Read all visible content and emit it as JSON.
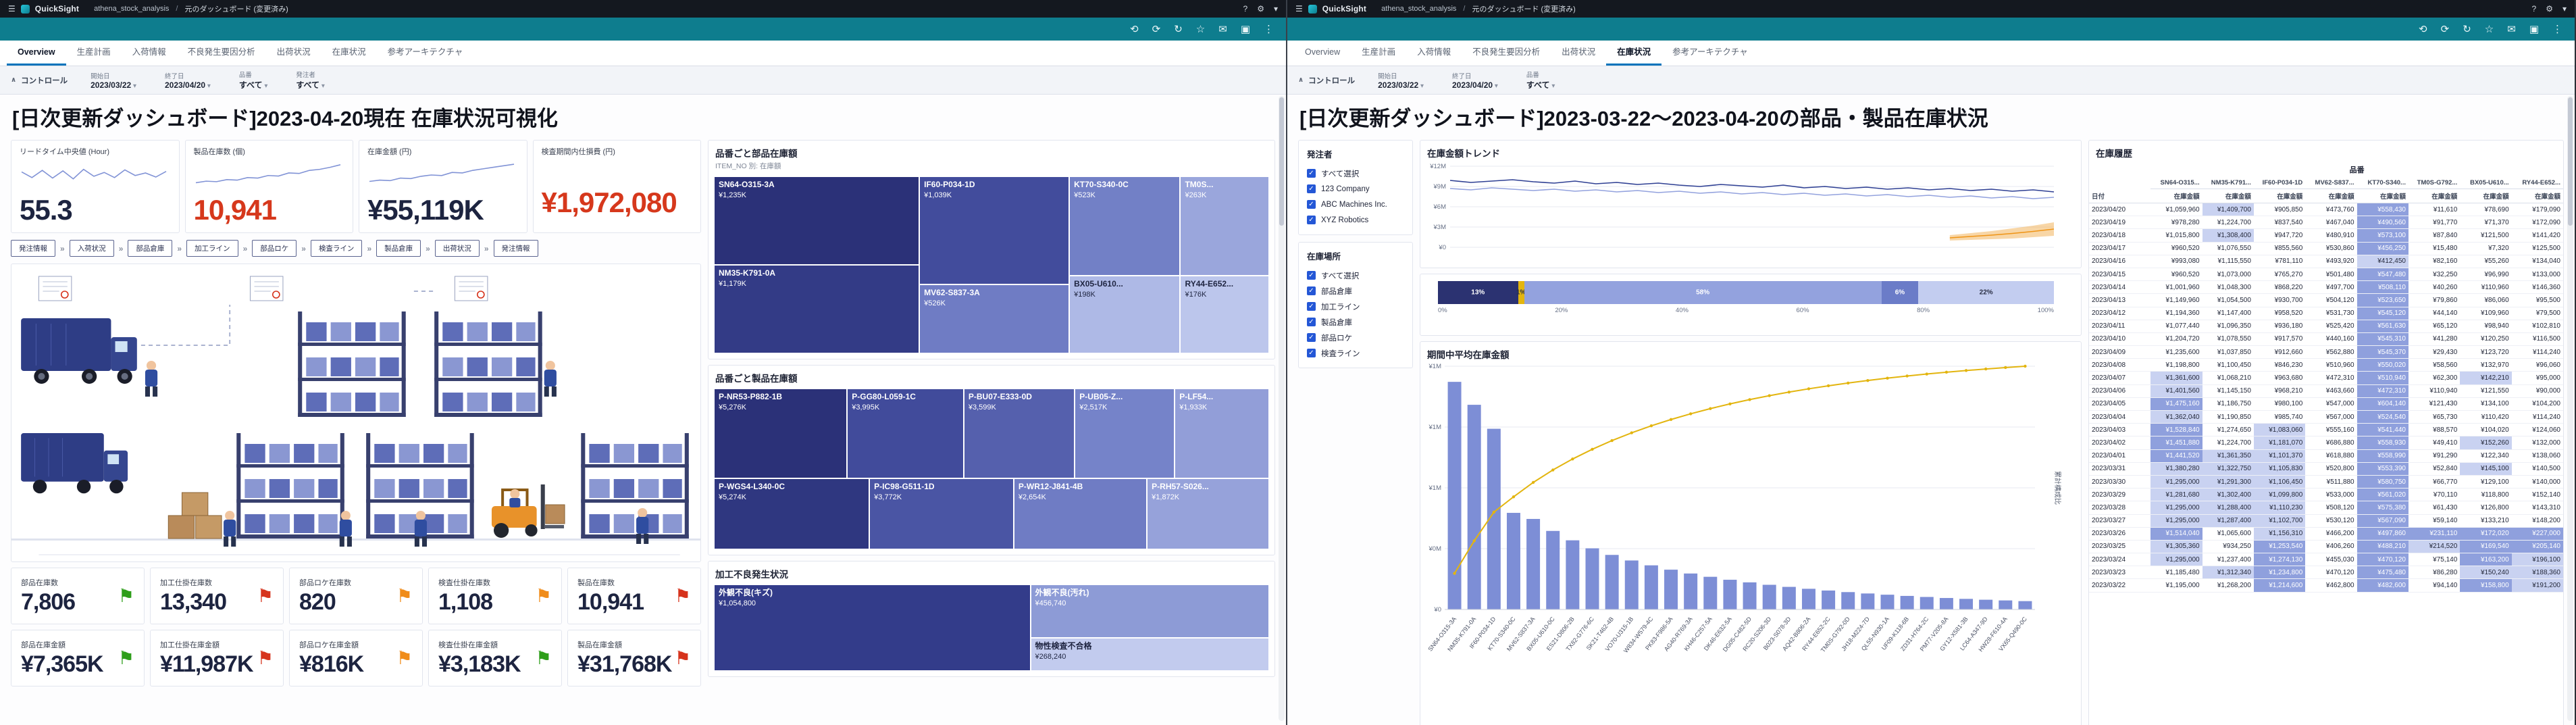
{
  "chrome": {
    "logo": "QuickSight",
    "menu_glyph": "☰",
    "breadcrumb": {
      "project": "athena_stock_analysis",
      "separator": "/",
      "page": "元のダッシュボード (変更済み)"
    },
    "top_icons": [
      {
        "name": "help-icon",
        "glyph": "?"
      },
      {
        "name": "settings-icon",
        "glyph": "⚙"
      },
      {
        "name": "user-menu-icon",
        "glyph": "▾"
      }
    ],
    "teal_icons": [
      {
        "name": "undo-icon",
        "glyph": "⟲"
      },
      {
        "name": "redo-icon",
        "glyph": "⟳"
      },
      {
        "name": "refresh-icon",
        "glyph": "↻"
      },
      {
        "name": "bookmark-icon",
        "glyph": "☆"
      },
      {
        "name": "email-report-icon",
        "glyph": "✉"
      },
      {
        "name": "fullscreen-icon",
        "glyph": "▣"
      },
      {
        "name": "more-menu-icon",
        "glyph": "⋮"
      }
    ],
    "tabs": [
      "Overview",
      "生産計画",
      "入荷情報",
      "不良発生要因分析",
      "出荷状況",
      "在庫状況",
      "参考アーキテクチャ"
    ]
  },
  "left": {
    "active_tab": "Overview",
    "controls": {
      "section_label": "コントロール",
      "items": [
        {
          "label": "開始日",
          "value": "2023/03/22"
        },
        {
          "label": "終了日",
          "value": "2023/04/20"
        },
        {
          "label": "品番",
          "value": "すべて"
        },
        {
          "label": "発注者",
          "value": "すべて"
        }
      ]
    },
    "title": "[日次更新ダッシュボード]2023-04-20現在 在庫状況可視化",
    "kpis": [
      {
        "label": "リードタイム中央値 (Hour)",
        "value": "55.3",
        "color": "dark",
        "spark": [
          62,
          40,
          68,
          38,
          66,
          35,
          72,
          45,
          60,
          40,
          70,
          48,
          58,
          42,
          64
        ]
      },
      {
        "label": "製品在庫数 (個)",
        "value": "10,941",
        "color": "red",
        "spark": [
          20,
          26,
          24,
          32,
          30,
          40,
          38,
          48,
          46,
          58,
          56,
          68,
          72,
          80,
          90
        ]
      },
      {
        "label": "在庫金額 (円)",
        "value": "¥55,119K",
        "color": "dark",
        "spark": [
          25,
          30,
          28,
          38,
          36,
          45,
          50,
          48,
          60,
          58,
          68,
          74,
          80,
          86,
          92
        ]
      },
      {
        "label": "検査期間内仕損費 (円)",
        "value": "¥1,972,080",
        "color": "red"
      }
    ],
    "flow": [
      "発注情報",
      "入荷状況",
      "部品倉庫",
      "加工ライン",
      "部品ロケ",
      "検査ライン",
      "製品倉庫",
      "出荷状況",
      "発注情報"
    ],
    "counts": [
      {
        "label": "部品在庫数",
        "value": "7,806",
        "flag": "green"
      },
      {
        "label": "加工仕掛在庫数",
        "value": "13,340",
        "flag": "red"
      },
      {
        "label": "部品ロケ在庫数",
        "value": "820",
        "flag": "orange"
      },
      {
        "label": "検査仕掛在庫数",
        "value": "1,108",
        "flag": "orange"
      },
      {
        "label": "製品在庫数",
        "value": "10,941",
        "flag": "red"
      }
    ],
    "amounts": [
      {
        "label": "部品在庫金額",
        "value": "¥7,365K",
        "flag": "green"
      },
      {
        "label": "加工仕掛在庫金額",
        "value": "¥11,987K",
        "flag": "red"
      },
      {
        "label": "部品ロケ在庫金額",
        "value": "¥816K",
        "flag": "orange"
      },
      {
        "label": "検査仕掛在庫金額",
        "value": "¥3,183K",
        "flag": "green"
      },
      {
        "label": "製品在庫金額",
        "value": "¥31,768K",
        "flag": "red"
      }
    ],
    "flag_colors": {
      "green": "#2e9e1a",
      "red": "#d6331c",
      "orange": "#f08c1a"
    },
    "treemap_parts": {
      "title": "品番ごと部品在庫額",
      "subtitle": "ITEM_NO 別: 在庫額",
      "items": [
        {
          "name": "SN64-O315-3A",
          "value": "¥1,235K",
          "color": "#2b3178"
        },
        {
          "name": "NM35-K791-0A",
          "value": "¥1,179K",
          "color": "#333b86"
        },
        {
          "name": "IF60-P034-1D",
          "value": "¥1,039K",
          "color": "#424c9c"
        },
        {
          "name": "MV62-S837-3A",
          "value": "¥526K",
          "color": "#6f7cc4"
        },
        {
          "name": "KT70-S340-0C",
          "value": "¥523K",
          "color": "#7280c6"
        },
        {
          "name": "TM0S...",
          "value": "¥263K",
          "color": "#9aa6dc"
        },
        {
          "name": "BX05-U610...",
          "value": "¥198K",
          "color": "#aeb9e6",
          "text": "dark"
        },
        {
          "name": "RY44-E652...",
          "value": "¥176K",
          "color": "#bcc6ec",
          "text": "dark"
        }
      ]
    },
    "treemap_products": {
      "title": "品番ごと製品在庫額",
      "items": [
        {
          "name": "P-NR53-P882-1B",
          "value": "¥5,276K",
          "color": "#2b3178"
        },
        {
          "name": "P-GG80-L059-1C",
          "value": "¥3,995K",
          "color": "#414b9b"
        },
        {
          "name": "P-BU07-E333-0D",
          "value": "¥3,599K",
          "color": "#5560ad"
        },
        {
          "name": "P-UB05-Z...",
          "value": "¥2,517K",
          "color": "#7583c9"
        },
        {
          "name": "P-LF54...",
          "value": "¥1,933K",
          "color": "#929ed8"
        },
        {
          "name": "P-WGS4-L340-0C",
          "value": "¥5,274K",
          "color": "#2f3780"
        },
        {
          "name": "P-IC98-G511-1D",
          "value": "¥3,772K",
          "color": "#4a55a4"
        },
        {
          "name": "P-WR12-J841-4B",
          "value": "¥2,654K",
          "color": "#6f7cc4"
        },
        {
          "name": "P-RH57-S026...",
          "value": "¥1,872K",
          "color": "#96a2da"
        }
      ]
    },
    "treemap_defects": {
      "title": "加工不良発生状況",
      "items": [
        {
          "name": "外観不良(キズ)",
          "value": "¥1,054,800",
          "color": "#333c8a"
        },
        {
          "name": "外観不良(汚れ)",
          "value": "¥456,740",
          "color": "#8d9bd6"
        },
        {
          "name": "物性検査不合格",
          "value": "¥268,240",
          "color": "#c2cbee",
          "text": "dark"
        }
      ]
    }
  },
  "right": {
    "active_tab": "在庫状況",
    "controls": {
      "section_label": "コントロール",
      "items": [
        {
          "label": "開始日",
          "value": "2023/03/22"
        },
        {
          "label": "終了日",
          "value": "2023/04/20"
        },
        {
          "label": "品番",
          "value": "すべて"
        }
      ]
    },
    "title": "[日次更新ダッシュボード]2023-03-22〜2023-04-20の部品・製品在庫状況",
    "filters": [
      {
        "title": "発注者",
        "options": [
          "すべて選択",
          "123 Company",
          "ABC Machines Inc.",
          "XYZ Robotics"
        ]
      },
      {
        "title": "在庫場所",
        "options": [
          "すべて選択",
          "部品倉庫",
          "加工ライン",
          "製品倉庫",
          "部品ロケ",
          "検査ライン"
        ]
      }
    ],
    "trend": {
      "title": "在庫金額トレンド",
      "y_ticks": [
        "¥12M",
        "¥9M",
        "¥6M",
        "¥3M",
        "¥0"
      ],
      "y_max": 12,
      "series": [
        {
          "color": "#2e3f93",
          "values": [
            9.9,
            9.6,
            9.8,
            10.0,
            9.7,
            9.5,
            9.8,
            9.4,
            9.6,
            9.3,
            9.5,
            9.2,
            9.0,
            9.3,
            9.1,
            8.9,
            9.2,
            8.8,
            9.0,
            8.7,
            8.9,
            8.6,
            8.8,
            8.5,
            8.7,
            8.4,
            8.6,
            8.3,
            8.5,
            8.2
          ]
        },
        {
          "color": "#93a2de",
          "values": [
            8.7,
            8.5,
            8.8,
            8.6,
            8.4,
            8.6,
            8.3,
            8.5,
            8.2,
            8.4,
            8.1,
            8.3,
            8.0,
            8.2,
            7.9,
            8.1,
            7.8,
            8.0,
            7.7,
            7.9,
            7.6,
            7.8,
            7.5,
            7.7,
            7.4,
            7.6,
            7.3,
            7.5,
            7.2,
            7.4
          ]
        }
      ],
      "forecast": {
        "color": "#f0a33a",
        "lower": [
          1.0,
          1.1,
          1.2,
          1.3,
          1.5,
          1.7
        ],
        "upper": [
          1.8,
          2.1,
          2.4,
          2.8,
          3.2,
          3.7
        ]
      }
    },
    "stacked": {
      "segments": [
        {
          "label": "13%",
          "value": 13,
          "color": "#2b3271",
          "text": "#ffffff"
        },
        {
          "label": "1%",
          "value": 1,
          "color": "#e3b50f",
          "text": "#2a2f45"
        },
        {
          "label": "58%",
          "value": 58,
          "color": "#93a2de",
          "text": "#ffffff"
        },
        {
          "label": "6%",
          "value": 6,
          "color": "#6b7cc8",
          "text": "#ffffff"
        },
        {
          "label": "22%",
          "value": 22,
          "color": "#c3cdf0",
          "text": "#2a2f45"
        }
      ],
      "x_ticks": [
        "0%",
        "20%",
        "40%",
        "60%",
        "80%",
        "100%"
      ]
    },
    "pareto": {
      "title": "期間中平均在庫金額",
      "right_axis_label": "累計構成比",
      "y_ticks": [
        "¥1M",
        "¥1M",
        "¥1M",
        "¥0M",
        "¥0"
      ],
      "y_max_k": 1400,
      "bar_color": "#7d8ed6",
      "line_color": "#e3b50f",
      "labels": [
        "SN64-O315-3A",
        "NM35-K791-0A",
        "IF60-P034-1D",
        "KT70-S340-0C",
        "MV62-S837-3A",
        "BX05-U610-0C",
        "ES21-D806-2B",
        "TX82-G776-6C",
        "SK21-T462-4B",
        "VO70-U315-1B",
        "W834-W579-4C",
        "PK83-F986-5A",
        "AG40-R769-3A",
        "KH46-C257-5A",
        "DK46-E632-5A",
        "DG05-C482-5D",
        "RC20-S206-3D",
        "B023-S078-3D",
        "AQ42-B806-2A",
        "RY44-E652-2C",
        "TM0S-G792-0D",
        "JH18-M224-7D",
        "QL55-N930-1A",
        "UF09-K118-6B",
        "ZD31-H764-2C",
        "PM77-V205-8A",
        "GY12-X581-3B",
        "LC64-A347-9D",
        "HW28-F610-4A",
        "VX65-Q490-0C"
      ],
      "values_k": [
        1310,
        1178,
        1040,
        556,
        521,
        452,
        398,
        352,
        314,
        282,
        254,
        229,
        207,
        188,
        171,
        156,
        142,
        130,
        119,
        109,
        100,
        92,
        85,
        78,
        72,
        66,
        61,
        56,
        52,
        48
      ]
    },
    "history": {
      "title": "在庫履歴",
      "group_header": "品番",
      "date_header": "日付",
      "measure_header": "在庫金額",
      "columns": [
        "SN64-O315...",
        "NM35-K791...",
        "IF60-P034-1D",
        "MV62-S837...",
        "KT70-S340...",
        "TM0S-G792...",
        "BX05-U610...",
        "RY44-E652..."
      ],
      "rows": [
        [
          "2023/04/20",
          1059960,
          1409700,
          905850,
          473760,
          558430,
          11610,
          78690,
          179090
        ],
        [
          "2023/04/19",
          978280,
          1224700,
          837540,
          467040,
          490560,
          91770,
          71370,
          172090
        ],
        [
          "2023/04/18",
          1015800,
          1308400,
          947720,
          480910,
          573100,
          87840,
          121500,
          141420
        ],
        [
          "2023/04/17",
          960520,
          1076550,
          855560,
          530860,
          456250,
          15480,
          7320,
          125500
        ],
        [
          "2023/04/16",
          993080,
          1115550,
          781110,
          493920,
          412450,
          82160,
          55260,
          134040
        ],
        [
          "2023/04/15",
          960520,
          1073000,
          765270,
          501480,
          547480,
          32250,
          96990,
          133000
        ],
        [
          "2023/04/14",
          1001960,
          1048300,
          868220,
          497700,
          508110,
          40260,
          110960,
          146360
        ],
        [
          "2023/04/13",
          1149960,
          1054500,
          930700,
          504120,
          523650,
          79860,
          86060,
          95500
        ],
        [
          "2023/04/12",
          1194360,
          1147400,
          958520,
          531730,
          545120,
          44140,
          109960,
          79500
        ],
        [
          "2023/04/11",
          1077440,
          1096350,
          936180,
          525420,
          561630,
          65120,
          98940,
          102810
        ],
        [
          "2023/04/10",
          1204720,
          1078550,
          917570,
          440160,
          545310,
          41280,
          120250,
          116500
        ],
        [
          "2023/04/09",
          1235600,
          1037850,
          912660,
          562880,
          545370,
          29430,
          123720,
          114240
        ],
        [
          "2023/04/08",
          1198800,
          1100450,
          846230,
          510960,
          550020,
          58560,
          132970,
          96060
        ],
        [
          "2023/04/07",
          1361600,
          1068210,
          963680,
          472310,
          510940,
          62300,
          142210,
          95000
        ],
        [
          "2023/04/06",
          1401560,
          1145150,
          968210,
          463660,
          472310,
          110940,
          121550,
          90000
        ],
        [
          "2023/04/05",
          1475160,
          1186750,
          980100,
          547000,
          604140,
          121430,
          134100,
          104200
        ],
        [
          "2023/04/04",
          1362040,
          1190850,
          985740,
          567000,
          524540,
          65730,
          110420,
          114240
        ],
        [
          "2023/04/03",
          1528840,
          1274650,
          1083060,
          555160,
          541440,
          88570,
          104020,
          124060
        ],
        [
          "2023/04/02",
          1451880,
          1224700,
          1181070,
          686880,
          558930,
          49410,
          152260,
          132000
        ],
        [
          "2023/04/01",
          1441520,
          1361350,
          1101370,
          618880,
          558990,
          91290,
          122340,
          138060
        ],
        [
          "2023/03/31",
          1380280,
          1322750,
          1105830,
          520800,
          553390,
          52840,
          145100,
          140500
        ],
        [
          "2023/03/30",
          1295000,
          1291300,
          1106450,
          511880,
          580750,
          66770,
          129100,
          140000
        ],
        [
          "2023/03/29",
          1281680,
          1302400,
          1099800,
          533000,
          561020,
          70110,
          118800,
          152140
        ],
        [
          "2023/03/28",
          1295000,
          1288400,
          1110230,
          508120,
          575380,
          61430,
          126800,
          143310
        ],
        [
          "2023/03/27",
          1295000,
          1287400,
          1102700,
          530120,
          567090,
          59140,
          133210,
          148200
        ],
        [
          "2023/03/26",
          1514040,
          1065600,
          1156310,
          466200,
          497860,
          231110,
          172020,
          227000
        ],
        [
          "2023/03/25",
          1305360,
          934250,
          1253540,
          406260,
          488210,
          214520,
          169540,
          205140
        ],
        [
          "2023/03/24",
          1295000,
          1237400,
          1274130,
          455030,
          470120,
          75140,
          163200,
          196100
        ],
        [
          "2023/03/23",
          1185480,
          1312340,
          1234800,
          470120,
          475480,
          86280,
          150240,
          188360
        ],
        [
          "2023/03/22",
          1195000,
          1268200,
          1214600,
          462800,
          482600,
          94140,
          158800,
          191200
        ]
      ]
    }
  }
}
